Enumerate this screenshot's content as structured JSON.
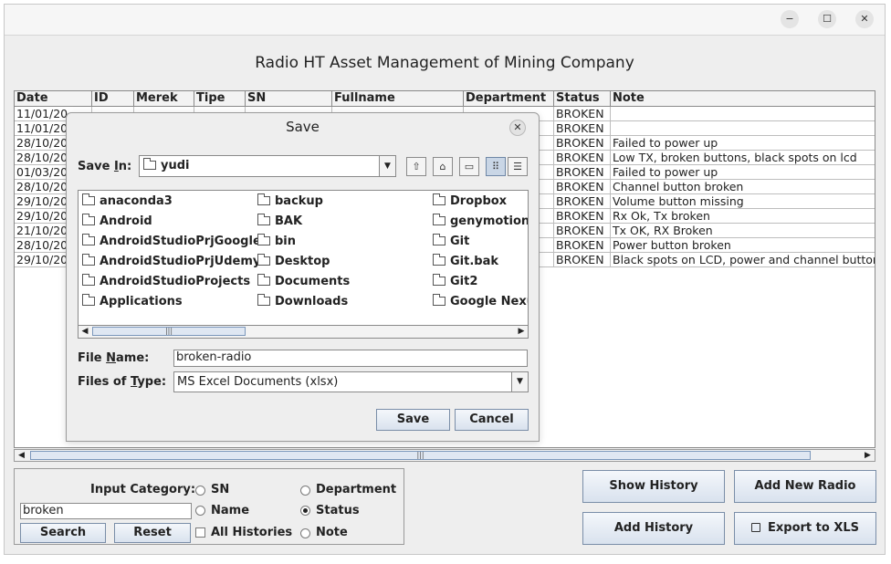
{
  "window": {
    "minimize_glyph": "−",
    "maximize_glyph": "☐",
    "close_glyph": "✕"
  },
  "app_title": "Radio HT Asset Management of Mining Company",
  "table": {
    "columns": [
      "Date",
      "ID",
      "Merek",
      "Tipe",
      "SN",
      "Fullname",
      "Department",
      "Status",
      "Note"
    ],
    "rows": [
      {
        "date": "11/01/20",
        "status": "BROKEN",
        "note": ""
      },
      {
        "date": "11/01/20",
        "status": "BROKEN",
        "note": ""
      },
      {
        "date": "28/10/20",
        "status": "BROKEN",
        "note": "Failed to power up"
      },
      {
        "date": "28/10/20",
        "status": "BROKEN",
        "note": "Low TX, broken buttons, black spots on lcd"
      },
      {
        "date": "01/03/20",
        "status": "BROKEN",
        "note": "Failed to power up"
      },
      {
        "date": "28/10/20",
        "status": "BROKEN",
        "note": "Channel button broken"
      },
      {
        "date": "29/10/20",
        "status": "BROKEN",
        "note": "Volume button missing"
      },
      {
        "date": "29/10/20",
        "status": "BROKEN",
        "note": "Rx Ok, Tx broken"
      },
      {
        "date": "21/10/20",
        "status": "BROKEN",
        "note": "Tx OK, RX Broken"
      },
      {
        "date": "28/10/20",
        "status": "BROKEN",
        "note": "Power button broken"
      },
      {
        "date": "29/10/20",
        "status": "BROKEN",
        "note": "Black spots on LCD, power and channel button"
      }
    ]
  },
  "search_panel": {
    "input_category_label": "Input Category:",
    "search_value": "broken",
    "options": {
      "sn": "SN",
      "department": "Department",
      "name": "Name",
      "status": "Status",
      "all_histories": "All Histories",
      "note": "Note"
    },
    "selected": "Status",
    "search_label": "Search",
    "reset_label": "Reset"
  },
  "actions": {
    "show_history": "Show History",
    "add_new_radio": "Add New Radio",
    "add_history": "Add History",
    "export_xls": "Export to XLS"
  },
  "dialog": {
    "title": "Save",
    "save_in_label": "Save In:",
    "save_in_value": "yudi",
    "files": [
      [
        "anaconda3",
        "Android",
        "AndroidStudioPrjGoogle",
        "AndroidStudioPrjUdemy",
        "AndroidStudioProjects",
        "Applications"
      ],
      [
        "backup",
        "BAK",
        "bin",
        "Desktop",
        "Documents",
        "Downloads"
      ],
      [
        "Dropbox",
        "genymotion",
        "Git",
        "Git.bak",
        "Git2",
        "Google Nexus"
      ]
    ],
    "file_name_label": "File Name:",
    "file_name_value": "broken-radio",
    "file_type_label": "Files of Type:",
    "file_type_value": "MS Excel Documents (xlsx)",
    "save_label": "Save",
    "cancel_label": "Cancel"
  }
}
